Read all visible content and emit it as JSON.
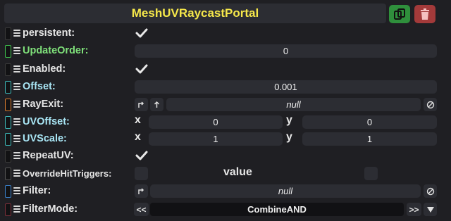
{
  "header": {
    "title": "MeshUVRaycastPortal"
  },
  "labels": {
    "persistent": "persistent:",
    "update_order": "UpdateOrder:",
    "enabled": "Enabled:",
    "offset": "Offset:",
    "ray_exit": "RayExit:",
    "uv_offset": "UVOffset:",
    "uv_scale": "UVScale:",
    "repeat_uv": "RepeatUV:",
    "override_hit_triggers": "OverrideHitTriggers:",
    "filter": "Filter:",
    "filter_mode": "FilterMode:"
  },
  "values": {
    "update_order": "0",
    "offset": "0.001",
    "ray_exit": "null",
    "uv_offset_x": "0",
    "uv_offset_y": "0",
    "uv_scale_x": "1",
    "uv_scale_y": "1",
    "override_value": "value",
    "filter": "null",
    "filter_mode": "CombineAND"
  },
  "axes": {
    "x": "x",
    "y": "y"
  },
  "glyphs": {
    "prev": "<<",
    "next": ">>"
  },
  "colors": {
    "title": "#f5e74a",
    "update_order_label": "#7fe07a",
    "offset_label": "#a9e6f5",
    "uv_label": "#a9e6f5",
    "duplicate_button": "#2f8f3c",
    "delete_button": "#a33a3a"
  }
}
